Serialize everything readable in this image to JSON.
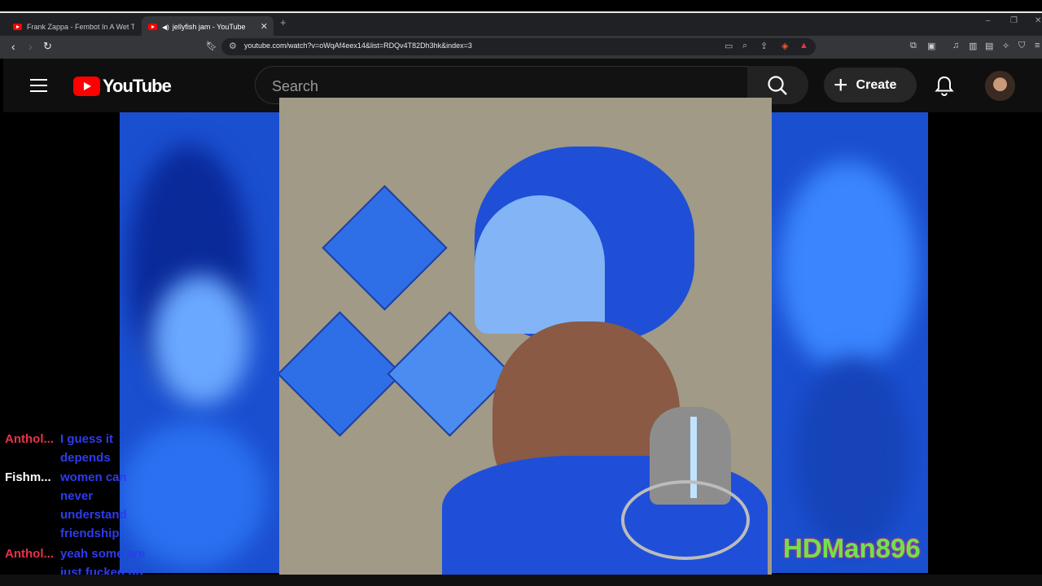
{
  "browser": {
    "tabs": [
      {
        "title": "Frank Zappa - Fembot In A Wet T-Sh",
        "active": false
      },
      {
        "title": "jellyfish jam - YouTube",
        "active": true
      }
    ],
    "new_tab_icon": "plus-icon",
    "url": "youtube.com/watch?v=oWqAf4eex14&list=RDQv4T82Dh3hk&index=3",
    "window_controls": {
      "minimize": "–",
      "restore": "❐",
      "close": "✕"
    }
  },
  "youtube": {
    "logo_text": "YouTube",
    "search_placeholder": "Search",
    "create_label": "Create",
    "brand_color": "#ff0000"
  },
  "video": {
    "watermark": "HDMan896"
  },
  "chat": [
    {
      "name": "Anthol...",
      "message": "I guess it depends",
      "name_color": "#e8324a"
    },
    {
      "name": "Fishm...",
      "message": "women can never understand friendship",
      "name_color": "#ffffff"
    },
    {
      "name": "Anthol...",
      "message": "yeah some are just fucked up",
      "name_color": "#e8324a"
    }
  ]
}
